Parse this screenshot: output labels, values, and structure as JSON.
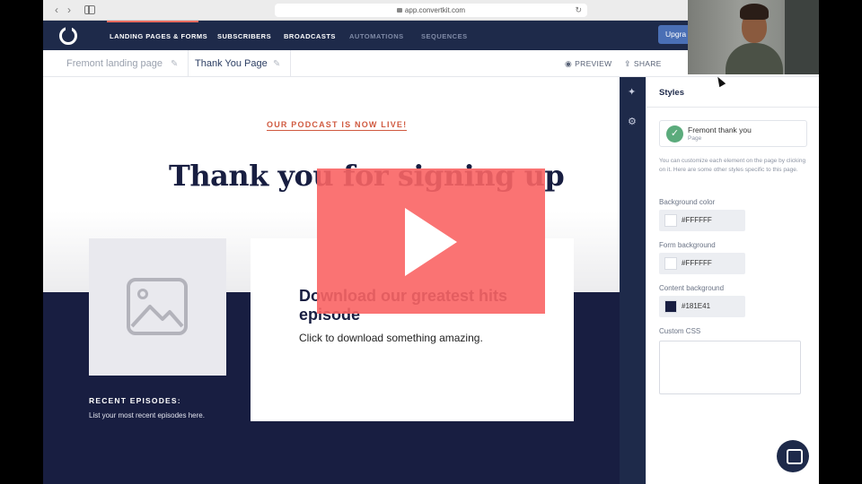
{
  "browser": {
    "url": "app.convertkit.com"
  },
  "nav": {
    "items": [
      {
        "label": "LANDING PAGES & FORMS",
        "active": true
      },
      {
        "label": "SUBSCRIBERS",
        "active": false
      },
      {
        "label": "BROADCASTS",
        "active": false
      },
      {
        "label": "AUTOMATIONS",
        "active": false
      },
      {
        "label": "SEQUENCES",
        "active": false
      }
    ],
    "upgrade_label": "Upgra"
  },
  "toolbar": {
    "crumbs": [
      "Fremont landing page",
      "Thank You Page"
    ],
    "preview_label": "PREVIEW",
    "share_label": "SHARE"
  },
  "page": {
    "podcast_link": "OUR PODCAST IS NOW LIVE!",
    "hero_title": "Thank you for signing up",
    "card_title": "Download our greatest hits episode",
    "card_sub": "Click to download something amazing.",
    "recent_title": "RECENT EPISODES:",
    "recent_sub": "List your most recent episodes here."
  },
  "settings": {
    "title": "Styles",
    "chip_name": "Fremont thank you",
    "chip_type": "Page",
    "help": "You can customize each element on the page by clicking on it. Here are some other styles specific to this page.",
    "fields": [
      {
        "label": "Background color",
        "value": "#FFFFFF",
        "swatch": "#FFFFFF"
      },
      {
        "label": "Form background",
        "value": "#FFFFFF",
        "swatch": "#FFFFFF"
      },
      {
        "label": "Content background",
        "value": "#181E41",
        "swatch": "#181E41"
      }
    ],
    "css_label": "Custom CSS"
  },
  "colors": {
    "nav_bg": "#1e2a4a",
    "navy": "#181e41",
    "accent": "#d05a40",
    "play_overlay": "#fa6464",
    "check_green": "#5bab7c"
  }
}
